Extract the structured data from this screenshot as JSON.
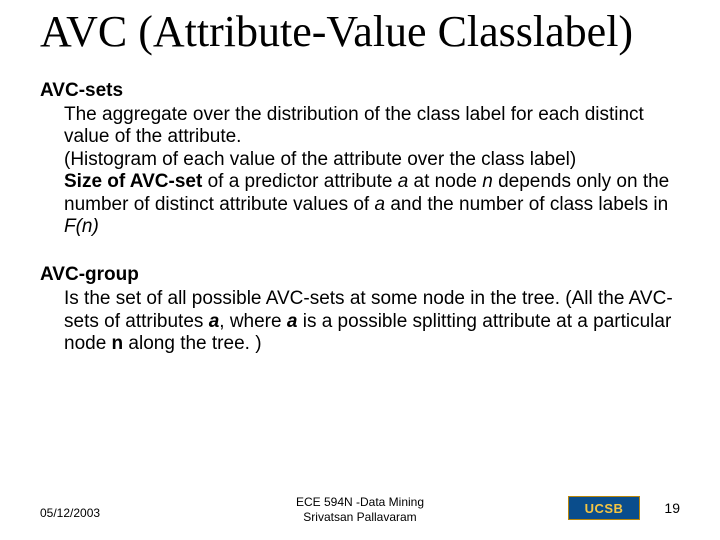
{
  "title": "AVC (Attribute-Value Classlabel)",
  "avcsets": {
    "head": "AVC-sets",
    "line1a": "The aggregate over the distribution of the class label for each distinct value of the attribute.",
    "line1b": "(Histogram of each value of the attribute over the class label)",
    "sizeof": "Size of AVC-set",
    "line1c_1": " of a predictor attribute ",
    "a": "a",
    "line1c_2": " at node ",
    "n": "n",
    "line1c_3": " depends only on the number of distinct attribute values of ",
    "line1c_4": " and the number of class labels in ",
    "fn": "F(n)"
  },
  "avcgroup": {
    "head": "AVC-group",
    "line1": "Is the set of all possible AVC-sets at some node in the tree. (All the AVC-sets of attributes ",
    "a": "a",
    "comma": ", where ",
    "line2": " is a possible splitting attribute at a particular node ",
    "n": "n",
    "line3": " along the tree. )"
  },
  "footer": {
    "date": "05/12/2003",
    "center1": "ECE 594N -Data Mining",
    "center2": "Srivatsan Pallavaram",
    "logo": "UCSB",
    "page": "19"
  }
}
